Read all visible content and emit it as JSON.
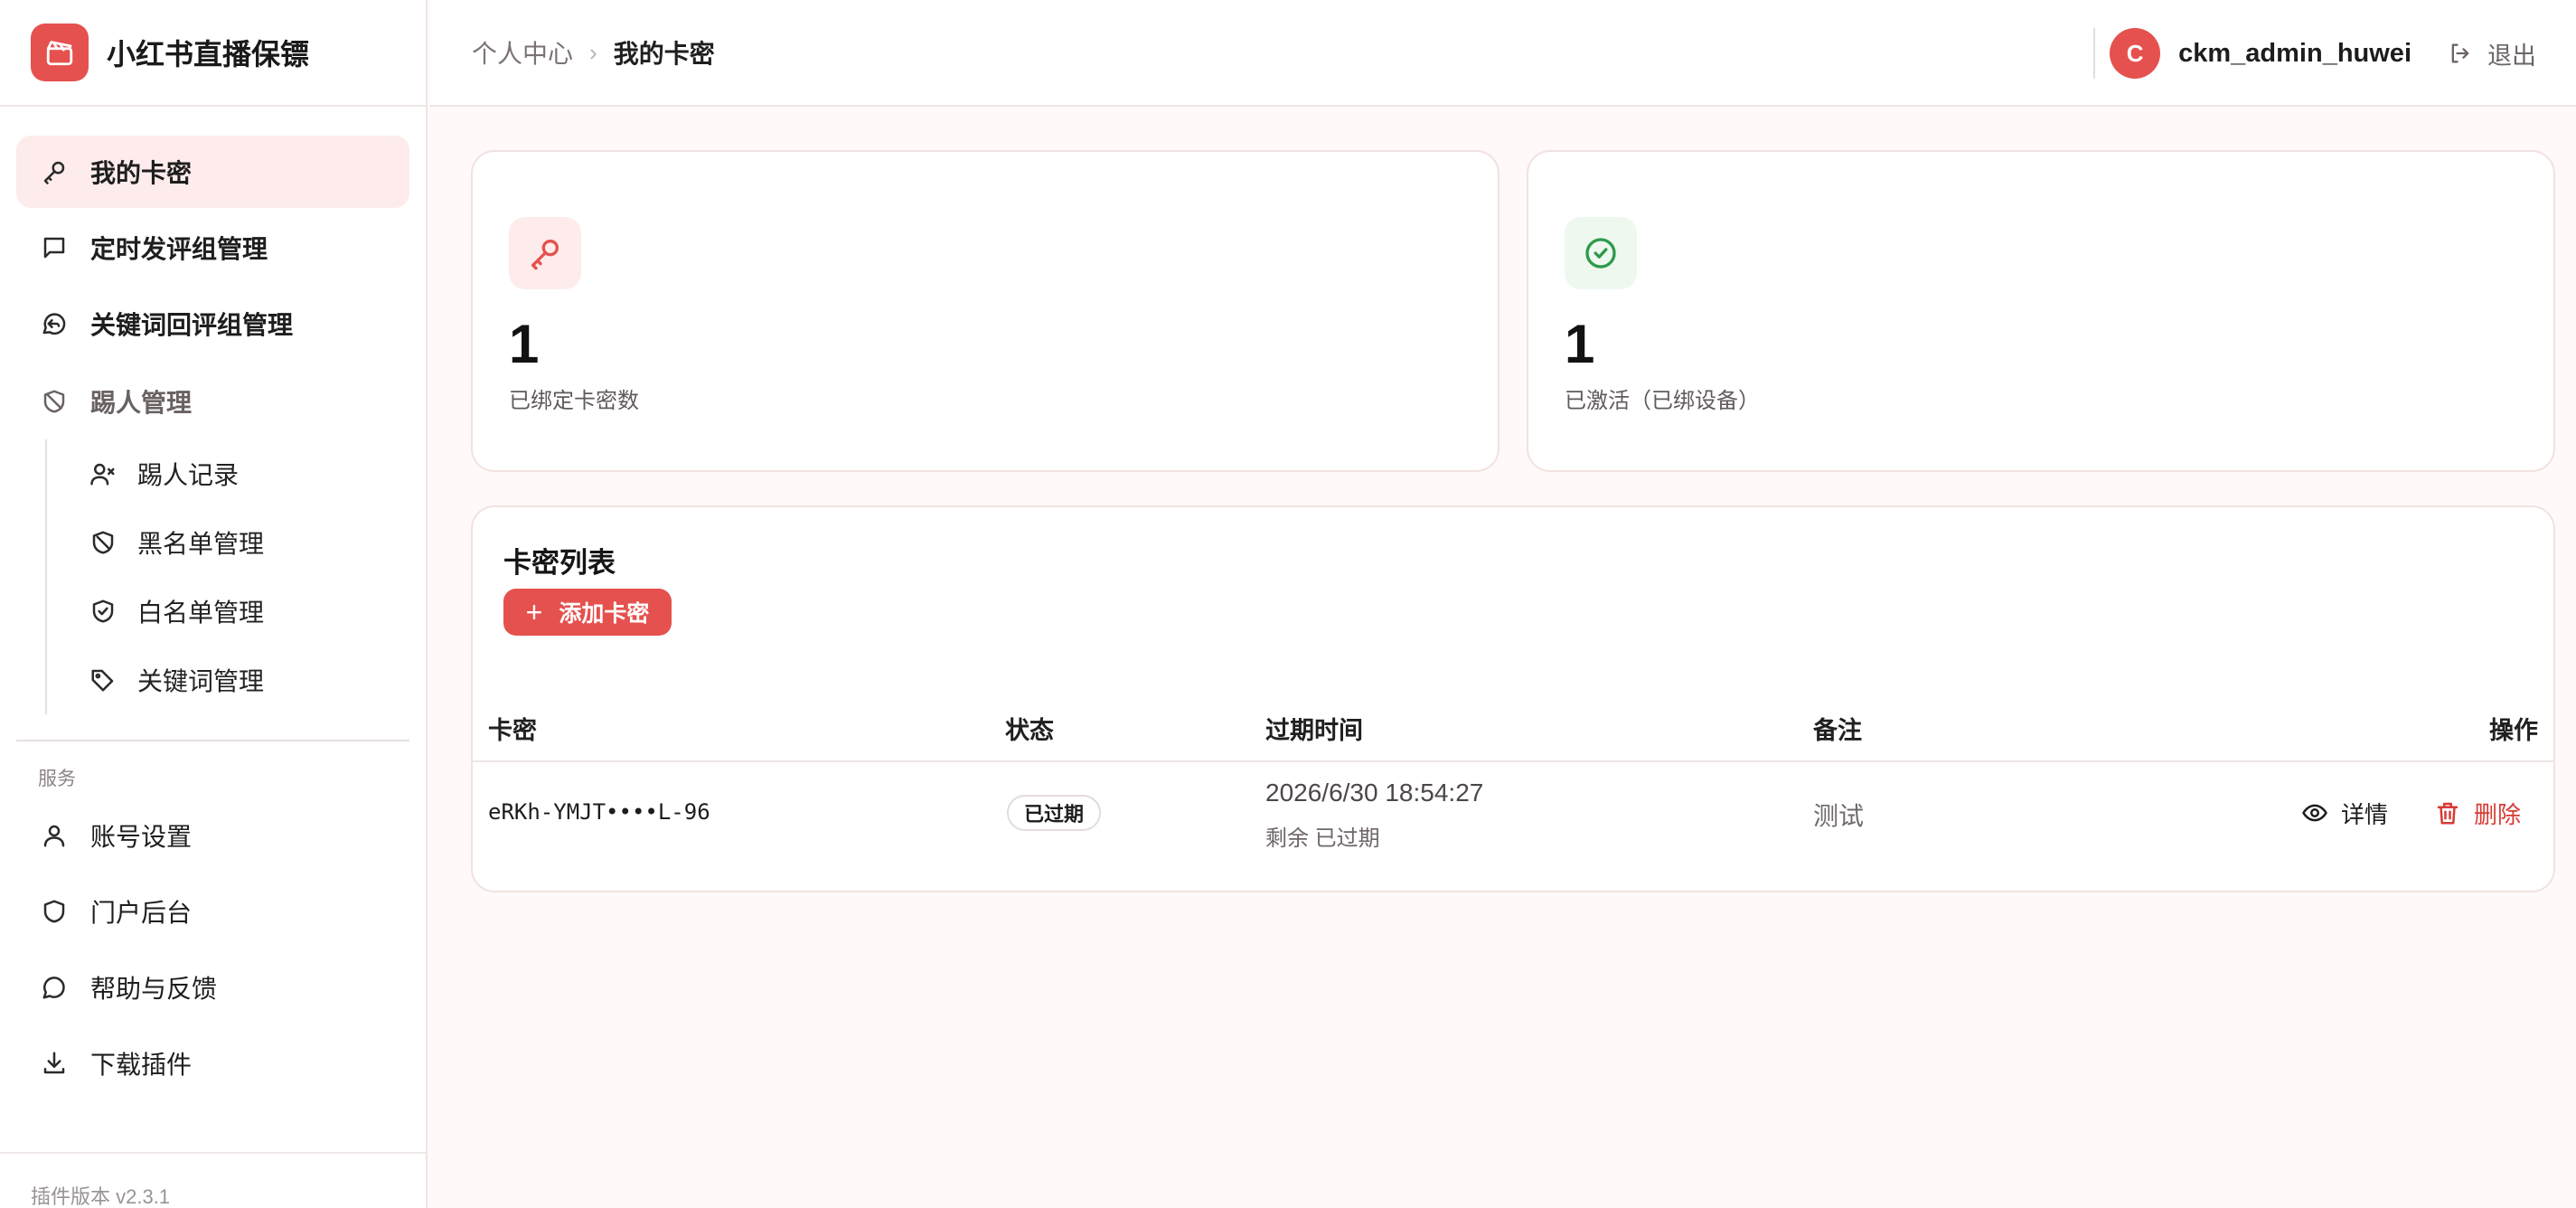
{
  "brand": {
    "name": "小红书直播保镖",
    "logo_icon": "clapperboard-icon"
  },
  "sidebar": {
    "items": [
      {
        "label": "我的卡密",
        "icon": "key-icon",
        "active": true
      },
      {
        "label": "定时发评组管理",
        "icon": "message-square-icon"
      },
      {
        "label": "关键词回评组管理",
        "icon": "reply-bubble-icon"
      }
    ],
    "group": {
      "label": "踢人管理",
      "icon": "shield-off-icon"
    },
    "sub_items": [
      {
        "label": "踢人记录",
        "icon": "user-x-icon"
      },
      {
        "label": "黑名单管理",
        "icon": "shield-ban-icon"
      },
      {
        "label": "白名单管理",
        "icon": "shield-check-icon"
      },
      {
        "label": "关键词管理",
        "icon": "tags-icon"
      }
    ],
    "section_label": "服务",
    "service_items": [
      {
        "label": "账号设置",
        "icon": "user-icon"
      },
      {
        "label": "门户后台",
        "icon": "shield-icon"
      },
      {
        "label": "帮助与反馈",
        "icon": "message-circle-icon"
      },
      {
        "label": "下载插件",
        "icon": "download-icon"
      }
    ],
    "footer": "插件版本 v2.3.1"
  },
  "header": {
    "breadcrumb": [
      "个人中心",
      "我的卡密"
    ],
    "avatar_letter": "C",
    "username": "ckm_admin_huwei",
    "logout_label": "退出"
  },
  "stats": [
    {
      "value": "1",
      "label": "已绑定卡密数",
      "icon": "key-icon",
      "color": "#e5514e"
    },
    {
      "value": "1",
      "label": "已激活（已绑设备）",
      "icon": "check-circle-icon",
      "color": "#2e9a4b"
    }
  ],
  "card_list": {
    "title": "卡密列表",
    "add_button": "添加卡密",
    "columns": [
      "卡密",
      "状态",
      "过期时间",
      "备注",
      "操作"
    ],
    "rows": [
      {
        "key": "eRKh-YMJT••••L-96",
        "status": "已过期",
        "expire_time": "2026/6/30 18:54:27",
        "remaining": "剩余 已过期",
        "remark": "测试",
        "detail_label": "详情",
        "delete_label": "删除"
      }
    ]
  },
  "colors": {
    "accent": "#e5514e",
    "success": "#2e9a4b",
    "danger": "#d83a35"
  }
}
